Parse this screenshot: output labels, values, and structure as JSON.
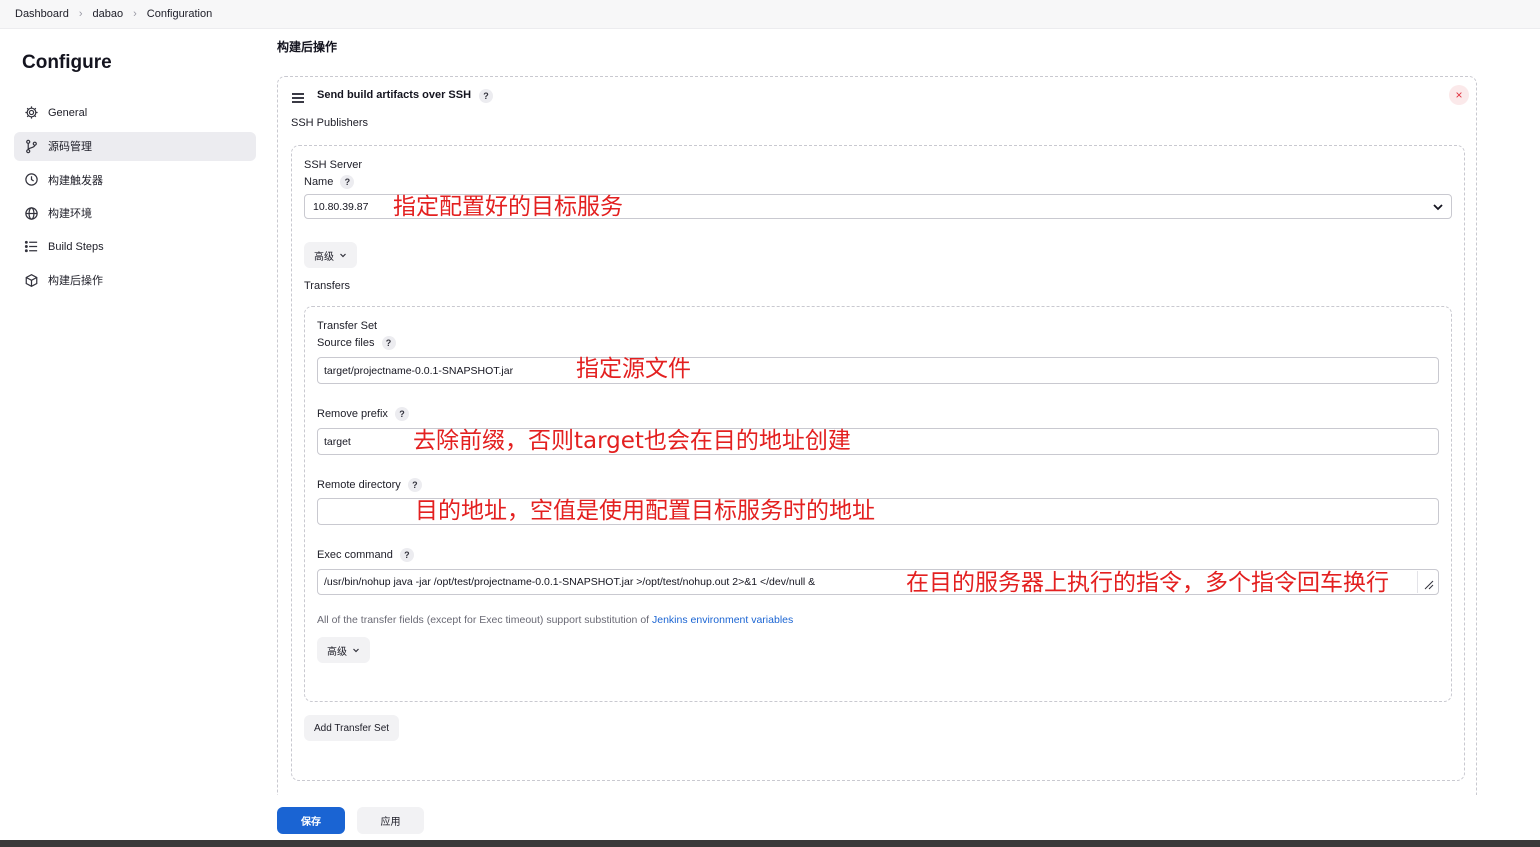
{
  "breadcrumb": {
    "items": [
      "Dashboard",
      "dabao",
      "Configuration"
    ]
  },
  "sidebar": {
    "title": "Configure",
    "items": [
      {
        "label": "General",
        "icon": "gear-icon"
      },
      {
        "label": "源码管理",
        "icon": "branch-icon",
        "active": true
      },
      {
        "label": "构建触发器",
        "icon": "clock-icon"
      },
      {
        "label": "构建环境",
        "icon": "globe-icon"
      },
      {
        "label": "Build Steps",
        "icon": "list-icon"
      },
      {
        "label": "构建后操作",
        "icon": "cube-icon"
      }
    ]
  },
  "main": {
    "section_title": "构建后操作",
    "builder": {
      "title": "Send build artifacts over SSH",
      "help": "?",
      "close": "×",
      "publishers_label": "SSH Publishers",
      "ssh_server_label": "SSH Server",
      "name_label": "Name",
      "name_value": "10.80.39.87",
      "advanced_label": "高级",
      "transfers_label": "Transfers",
      "transfer_set": {
        "title": "Transfer Set",
        "source_files_label": "Source files",
        "source_files_value": "target/projectname-0.0.1-SNAPSHOT.jar",
        "remove_prefix_label": "Remove prefix",
        "remove_prefix_value": "target",
        "remote_directory_label": "Remote directory",
        "remote_directory_value": "",
        "exec_command_label": "Exec command",
        "exec_command_value": "/usr/bin/nohup  java  -jar /opt/test/projectname-0.0.1-SNAPSHOT.jar >/opt/test/nohup.out 2>&1 </dev/null &",
        "note_text": "All of the transfer fields (except for Exec timeout) support substitution of ",
        "note_link": "Jenkins environment variables",
        "advanced_label": "高级"
      },
      "add_transfer_set_label": "Add Transfer Set"
    }
  },
  "annotations": {
    "name": "指定配置好的目标服务",
    "source": "指定源文件",
    "prefix": "去除前缀，否则target也会在目的地址创建",
    "remote": "目的地址，空值是使用配置目标服务时的地址",
    "exec": "在目的服务器上执行的指令，多个指令回车换行"
  },
  "footer": {
    "save_label": "保存",
    "apply_label": "应用"
  },
  "colors": {
    "accent": "#1a64d3",
    "annotation": "#e32020",
    "close": "#e0323f"
  }
}
